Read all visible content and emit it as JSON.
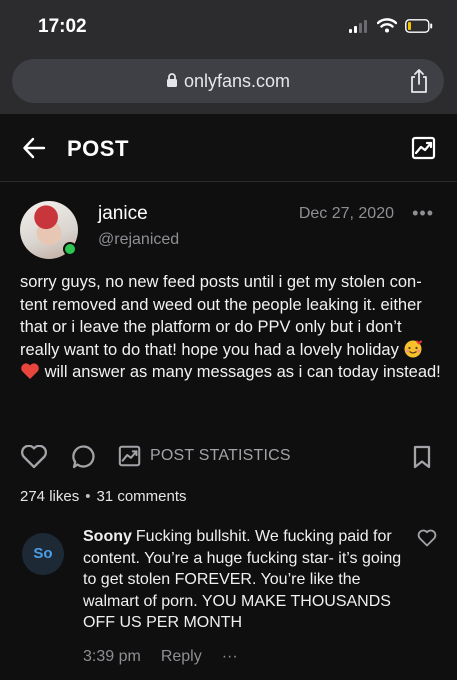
{
  "status_bar": {
    "time": "17:02"
  },
  "browser": {
    "url": "onlyfans.com"
  },
  "header": {
    "title": "POST"
  },
  "post": {
    "author_name": "janice",
    "author_handle": "@rejaniced",
    "date": "Dec 27, 2020",
    "more": "•••",
    "text_part1": "sorry guys, no new feed posts until i get my stolen con-tent removed and weed out the people leaking it. either that or i leave the platform or do PPV only but i don’t really want to do that! hope you had a lovely holiday ",
    "emoji_1": "smiling-face-with-hearts",
    "emoji_2": "red-heart",
    "text_part2": " will answer as many messages as i can today instead!",
    "stats_label": "POST STATISTICS",
    "likes": "274 likes",
    "comments": "31 comments",
    "bullet": "•"
  },
  "comment": {
    "avatar_initials": "So",
    "author": "Soony",
    "text": "Fucking bullshit. We fucking paid for content. You’re a huge fucking star- it’s going to get stolen FOREVER. You’re like the walmart of porn. YOU MAKE THOUSANDS OFF US PER MONTH",
    "time": "3:39 pm",
    "reply_label": "Reply",
    "more": "···"
  },
  "colors": {
    "background": "#0f0f10",
    "muted_text": "#8e8e93",
    "online": "#2dc653",
    "accent_blue": "#4b9ee8"
  }
}
